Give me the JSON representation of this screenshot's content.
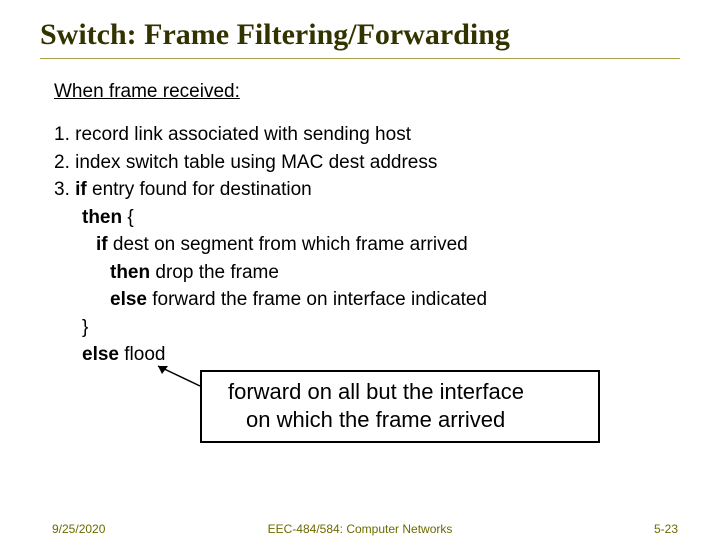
{
  "title": "Switch: Frame Filtering/Forwarding",
  "subhead": "When  frame received:",
  "l1": "1. record link associated with sending host",
  "l2": "2. index switch table using MAC dest address",
  "l3a": "3. ",
  "l3b": "if",
  "l3c": " entry found for destination",
  "l4a": "then",
  "l4b": " {",
  "l5a": "if",
  "l5b": " dest on segment from which frame arrived",
  "l6a": "then",
  "l6b": " drop the frame",
  "l7a": "else",
  "l7b": " forward the frame on interface indicated",
  "l8": "}",
  "l9a": "else",
  "l9b": " flood",
  "callout_line1": "forward on all but the interface",
  "callout_line2": "on which the frame arrived",
  "footer": {
    "date": "9/25/2020",
    "mid": "EEC-484/584: Computer Networks",
    "num": "5-23"
  }
}
